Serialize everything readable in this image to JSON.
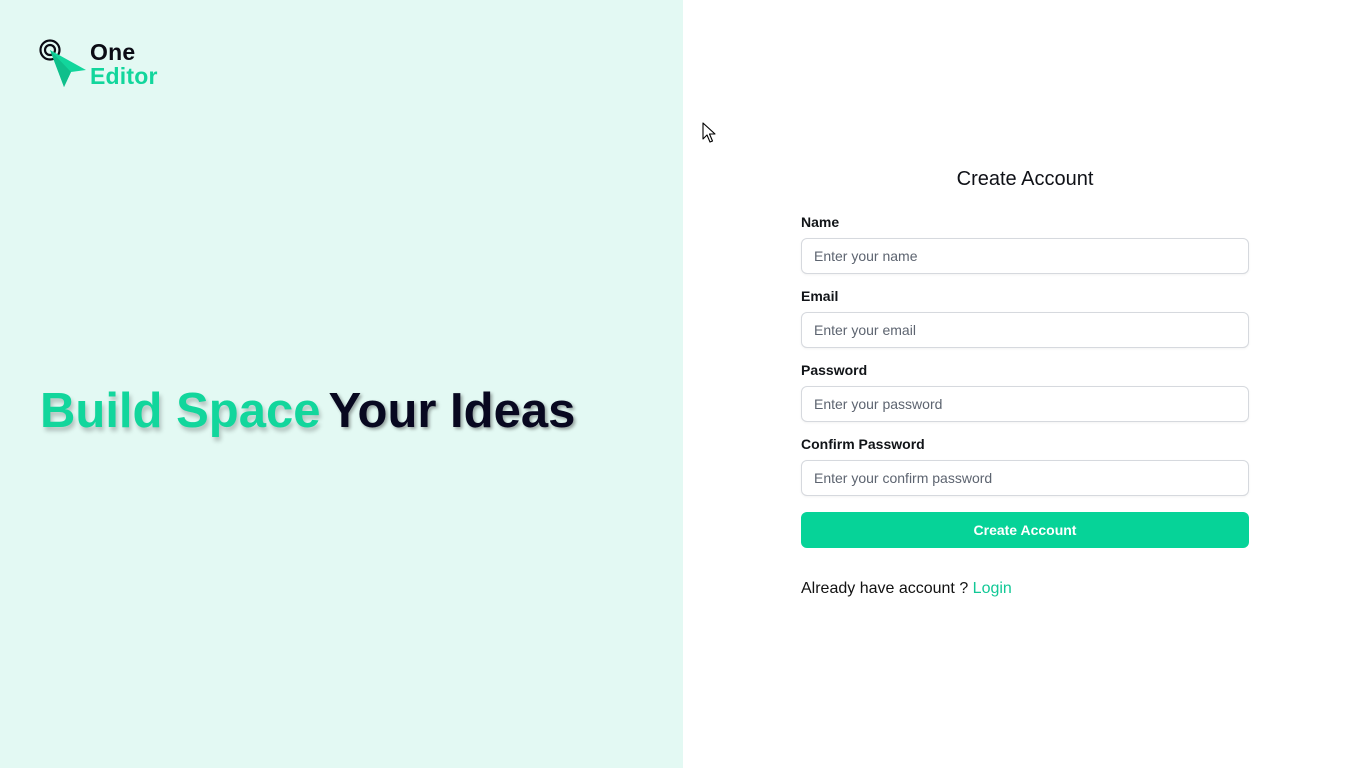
{
  "brand": {
    "name_line1": "One",
    "name_line2": "Editor",
    "logo_icon": "cursor-target-icon"
  },
  "hero": {
    "highlight": "Build Space",
    "rest": "Your Ideas"
  },
  "form": {
    "title": "Create Account",
    "fields": [
      {
        "label": "Name",
        "placeholder": "Enter your name",
        "value": ""
      },
      {
        "label": "Email",
        "placeholder": "Enter your email",
        "value": ""
      },
      {
        "label": "Password",
        "placeholder": "Enter your password",
        "value": ""
      },
      {
        "label": "Confirm Password",
        "placeholder": "Enter your confirm password",
        "value": ""
      }
    ],
    "submit_label": "Create Account",
    "login_prompt": "Already have account ?",
    "login_link": "Login"
  },
  "colors": {
    "accent": "#06d398",
    "left_panel_bg": "#e3f9f3",
    "dark_text": "#080820"
  }
}
